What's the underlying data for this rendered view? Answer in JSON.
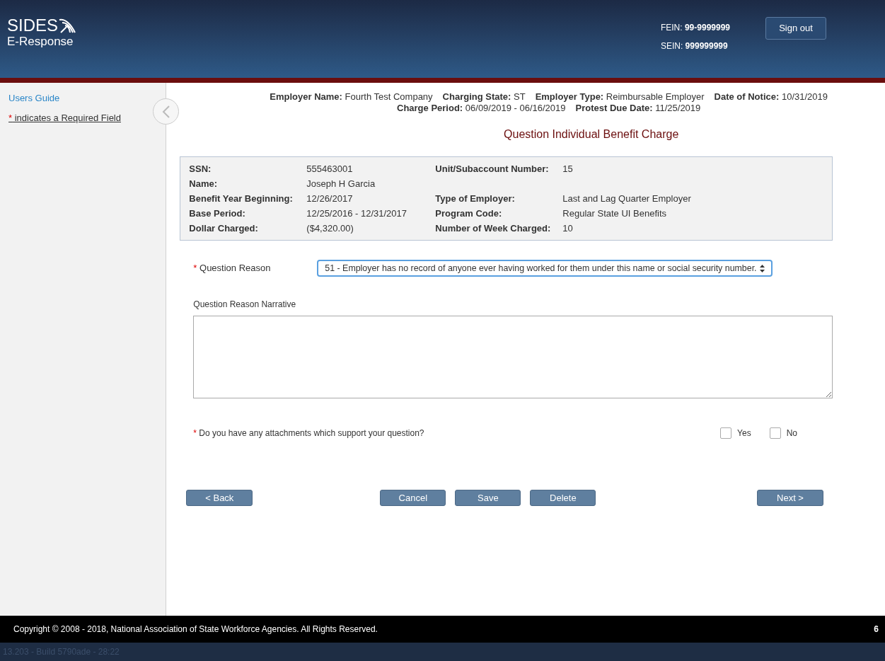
{
  "header": {
    "logo_title": "SIDES",
    "logo_subtitle": "E-Response",
    "fein_label": "FEIN:",
    "fein": "99-9999999",
    "sein_label": "SEIN:",
    "sein": "999999999",
    "sign_out": "Sign out"
  },
  "sidebar": {
    "users_guide": "Users Guide",
    "required_mark": "*",
    "required_note": " indicates a Required Field"
  },
  "claim_header": {
    "line_1": [
      {
        "label": "Employer Name:",
        "value": "Fourth Test Company"
      },
      {
        "label": "Charging State:",
        "value": "ST"
      },
      {
        "label": "Employer Type:",
        "value": "Reimbursable Employer"
      },
      {
        "label": "Date of Notice:",
        "value": "10/31/2019"
      }
    ],
    "line_2": [
      {
        "label": "Charge Period:",
        "value": "06/09/2019 - 06/16/2019"
      },
      {
        "label": "Protest Due Date:",
        "value": "11/25/2019"
      }
    ]
  },
  "page_title": "Question Individual Benefit Charge",
  "details": {
    "rows": [
      {
        "left": {
          "label": "SSN:",
          "value": "555463001"
        },
        "right": {
          "label": "Unit/Subaccount Number:",
          "value": "15"
        }
      },
      {
        "left": {
          "label": "Name:",
          "value": "Joseph H Garcia"
        }
      },
      {
        "left": {
          "label": "Benefit Year Beginning:",
          "value": "12/26/2017"
        },
        "right": {
          "label": "Type of Employer:",
          "value": "Last and Lag Quarter Employer"
        }
      },
      {
        "left": {
          "label": "Base Period:",
          "value": "12/25/2016 - 12/31/2017"
        },
        "right": {
          "label": "Program Code:",
          "value": "Regular State UI Benefits"
        }
      },
      {
        "left": {
          "label": "Dollar Charged:",
          "value": "($4,320.00)"
        },
        "right": {
          "label": "Number of Week Charged:",
          "value": "10"
        }
      }
    ]
  },
  "question_reason": {
    "required_mark": "*",
    "label": "Question Reason",
    "value": "51 - Employer has no record of anyone ever having worked for them under this name or social security number."
  },
  "narrative": {
    "label": "Question Reason Narrative"
  },
  "attachments": {
    "required_mark": "*",
    "question": "Do you have any attachments which support your question?",
    "options": [
      {
        "label": "Yes",
        "checked": false
      },
      {
        "label": "No",
        "checked": false
      }
    ]
  },
  "buttons": {
    "back": "< Back",
    "middle": [
      "Cancel",
      "Save",
      "Delete"
    ],
    "next": "Next >"
  },
  "footer": {
    "copyright": "Copyright © 2008 - 2018, National Association of State Workforce Agencies. All Rights Reserved.",
    "page_number": "6",
    "build": "13.203 - Build 5790ade - 28:22"
  }
}
